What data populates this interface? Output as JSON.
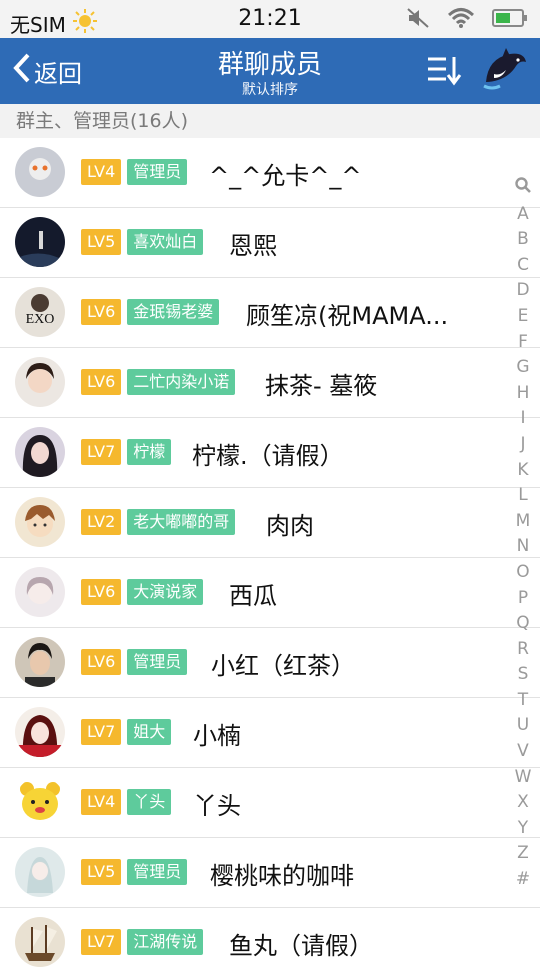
{
  "statusbar": {
    "carrier": "无SIM",
    "time": "21:21"
  },
  "header": {
    "back_label": "返回",
    "title": "群聊成员",
    "subtitle": "默认排序"
  },
  "section": {
    "label": "群主、管理员(16人)"
  },
  "members": [
    {
      "level": "LV4",
      "tag": "管理员",
      "name": "^_^允卡^_^"
    },
    {
      "level": "LV5",
      "tag": "喜欢灿白",
      "name": "恩熙"
    },
    {
      "level": "LV6",
      "tag": "金珉锡老婆",
      "name": "顾笙凉(祝MAMA..."
    },
    {
      "level": "LV6",
      "tag": "二忙内染小诺",
      "name": "抹茶- 墓筱"
    },
    {
      "level": "LV7",
      "tag": "柠檬",
      "name": "柠檬.（请假）"
    },
    {
      "level": "LV2",
      "tag": "老大嘟嘟的哥",
      "name": "肉肉"
    },
    {
      "level": "LV6",
      "tag": "大演说家",
      "name": "西瓜"
    },
    {
      "level": "LV6",
      "tag": "管理员",
      "name": "小红（红茶）"
    },
    {
      "level": "LV7",
      "tag": "姐大",
      "name": "小楠"
    },
    {
      "level": "LV4",
      "tag": "丫头",
      "name": "丫头"
    },
    {
      "level": "LV5",
      "tag": "管理员",
      "name": "樱桃味的咖啡"
    },
    {
      "level": "LV7",
      "tag": "江湖传说",
      "name": "鱼丸（请假）"
    }
  ],
  "index_letters": [
    "A",
    "B",
    "C",
    "D",
    "E",
    "F",
    "G",
    "H",
    "I",
    "J",
    "K",
    "L",
    "M",
    "N",
    "O",
    "P",
    "Q",
    "R",
    "S",
    "T",
    "U",
    "V",
    "W",
    "X",
    "Y",
    "Z",
    "#"
  ],
  "avatar_text_3": "EXO",
  "colors": {
    "titlebar": "#2e6bb6",
    "level_badge": "#f5b82e",
    "tag_badge": "#5ecb9c"
  }
}
